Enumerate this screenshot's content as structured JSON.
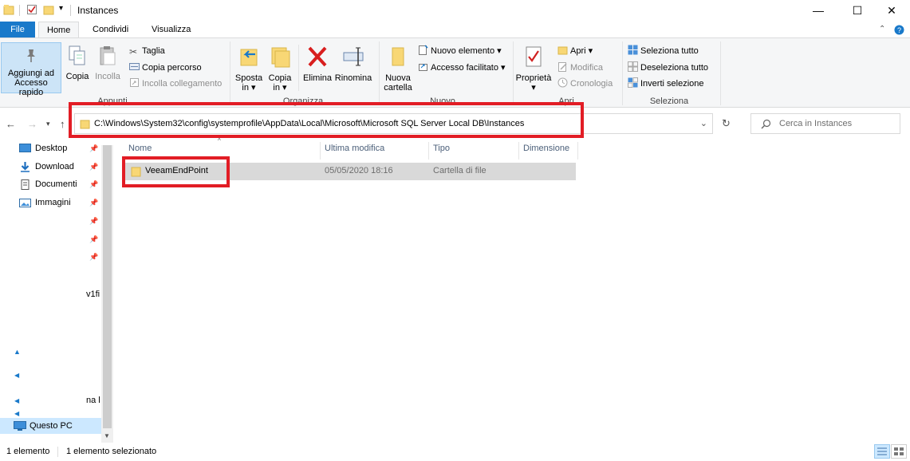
{
  "window": {
    "title": "Instances",
    "minimize": "—",
    "maximize": "☐",
    "close": "✕"
  },
  "tabs": {
    "file": "File",
    "home": "Home",
    "share": "Condividi",
    "view": "Visualizza"
  },
  "ribbon": {
    "clipboard": {
      "label": "Appunti",
      "pin_quick_access": [
        "Aggiungi ad",
        "Accesso rapido"
      ],
      "copy": "Copia",
      "paste": "Incolla",
      "cut": "Taglia",
      "copy_path": "Copia percorso",
      "paste_shortcut": "Incolla collegamento"
    },
    "organize": {
      "label": "Organizza",
      "move_to": [
        "Sposta",
        "in ▾"
      ],
      "copy_to": [
        "Copia",
        "in ▾"
      ],
      "delete": "Elimina",
      "rename": "Rinomina"
    },
    "new": {
      "label": "Nuovo",
      "new_folder": [
        "Nuova",
        "cartella"
      ],
      "new_item": "Nuovo elemento ▾",
      "easy_access": "Accesso facilitato ▾"
    },
    "open": {
      "label": "Apri",
      "properties": [
        "Proprietà",
        "▾"
      ],
      "open": "Apri ▾",
      "edit": "Modifica",
      "history": "Cronologia"
    },
    "select": {
      "label": "Seleziona",
      "select_all": "Seleziona tutto",
      "select_none": "Deseleziona tutto",
      "invert": "Inverti selezione"
    }
  },
  "address": {
    "path": "C:\\Windows\\System32\\config\\systemprofile\\AppData\\Local\\Microsoft\\Microsoft SQL Server Local DB\\Instances",
    "search_placeholder": "Cerca in Instances"
  },
  "nav_pane": {
    "items": [
      {
        "label": "Desktop",
        "icon": "desktop-icon"
      },
      {
        "label": "Download",
        "icon": "download-icon"
      },
      {
        "label": "Documenti",
        "icon": "documents-icon"
      },
      {
        "label": "Immagini",
        "icon": "pictures-icon"
      }
    ],
    "truncated_1": "v1fi",
    "truncated_2": "na l",
    "this_pc": "Questo PC"
  },
  "file_list": {
    "columns": [
      "Nome",
      "Ultima modifica",
      "Tipo",
      "Dimensione"
    ],
    "rows": [
      {
        "name": "VeeamEndPoint",
        "modified": "05/05/2020 18:16",
        "type": "Cartella di file",
        "size": ""
      }
    ]
  },
  "status": {
    "count": "1 elemento",
    "selected": "1 elemento selezionato"
  },
  "colors": {
    "file_tab": "#1979ca",
    "highlight_box": "#e21d25",
    "folder": "#f8d775",
    "row_selected": "#d9d9d9"
  }
}
